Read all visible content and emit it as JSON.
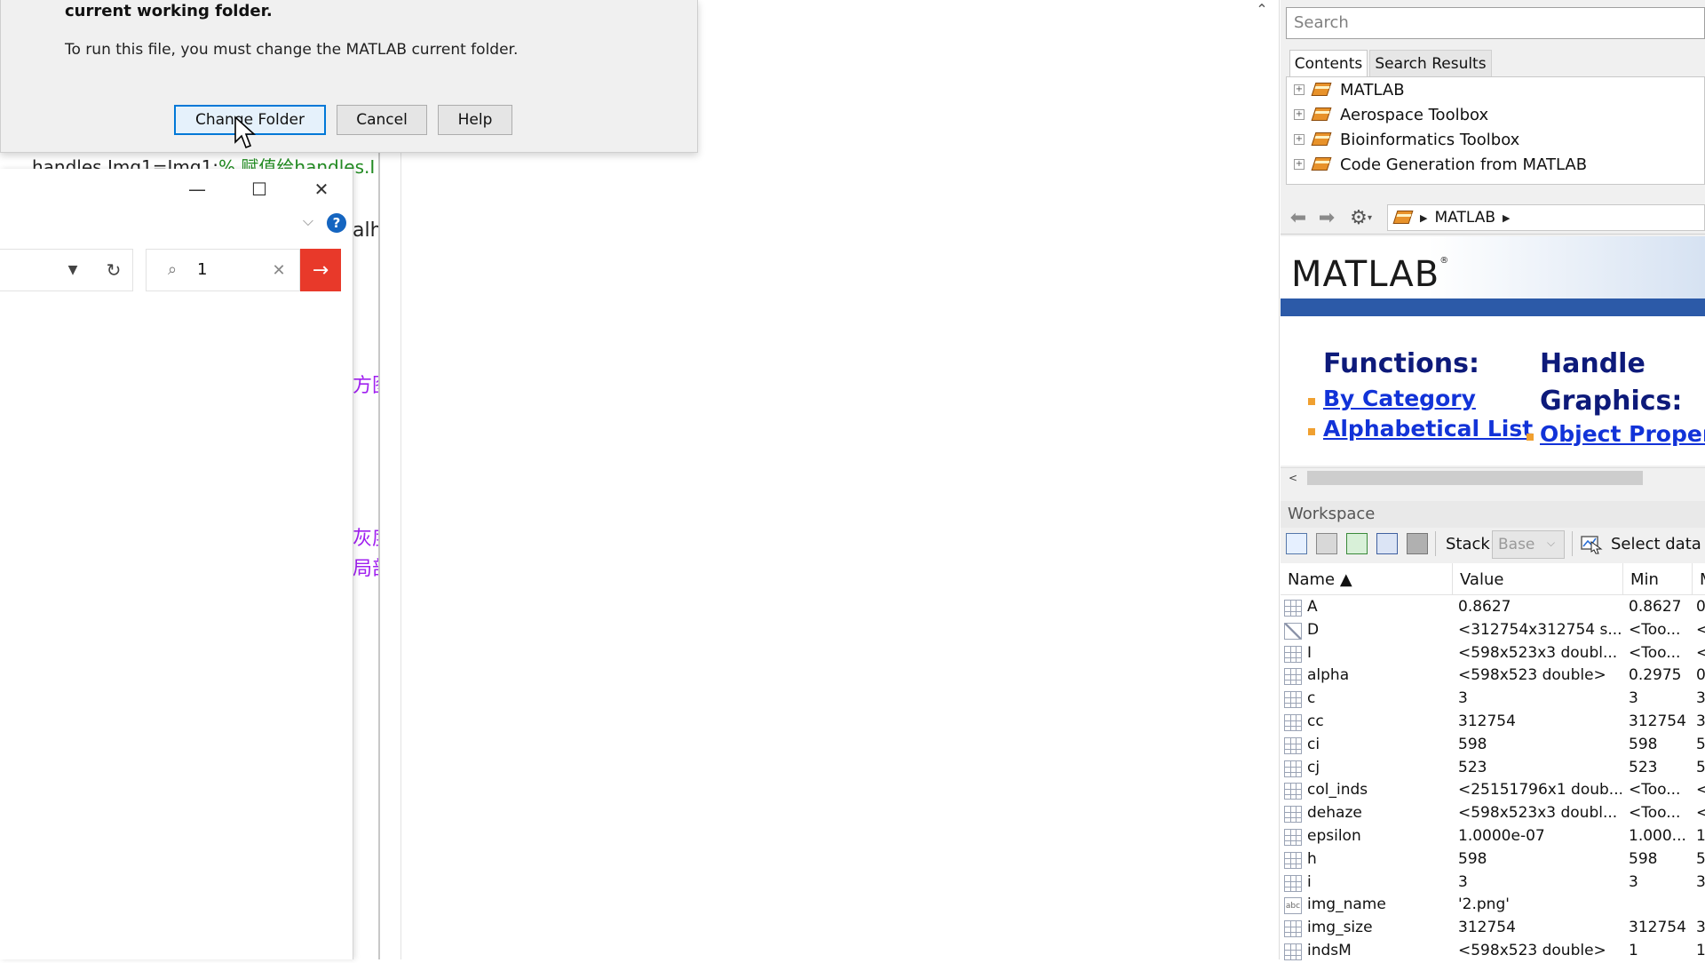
{
  "dialog": {
    "heading": "current working folder.",
    "message": "To run this file, you must change the MATLAB current folder.",
    "buttons": {
      "change_folder": "Change Folder",
      "cancel": "Cancel",
      "help": "Help"
    }
  },
  "editor": {
    "code_line": "handles.Img1=Img1;",
    "code_comment": "% 赋值给handles.I",
    "fragments": [
      "alh",
      "方图",
      "灰度",
      "局部"
    ]
  },
  "file_window": {
    "search_value": "1",
    "help_icon_glyph": "?",
    "controls": {
      "minimize": "—",
      "maximize": "☐",
      "close": "✕"
    }
  },
  "help_browser": {
    "search_placeholder": "Search",
    "tabs": [
      "Contents",
      "Search Results"
    ],
    "toc_items": [
      "MATLAB",
      "Aerospace Toolbox",
      "Bioinformatics Toolbox",
      "Code Generation from MATLAB"
    ],
    "breadcrumb": "MATLAB",
    "logo_text": "MATLAB",
    "logo_mark": "®",
    "content": {
      "functions_heading": "Functions:",
      "handle_heading": "Handle",
      "graphics_heading": "Graphics:",
      "link_by_category": "By Category",
      "link_alphabetical": "Alphabetical List",
      "link_object_properties": "Object Propert"
    }
  },
  "workspace": {
    "title": "Workspace",
    "stack_label": "Stack:",
    "stack_value": "Base",
    "select_data_label": "Select data t",
    "columns": {
      "name": "Name ▲",
      "value": "Value",
      "min": "Min",
      "max": "M"
    },
    "rows": [
      {
        "name": "A",
        "value": "0.8627",
        "min": "0.8627",
        "max": "0",
        "icon": "grid"
      },
      {
        "name": "D",
        "value": "<312754x312754 s...",
        "min": "<Too...",
        "max": "<",
        "icon": "sparse"
      },
      {
        "name": "I",
        "value": "<598x523x3 doubl...",
        "min": "<Too...",
        "max": "<",
        "icon": "grid"
      },
      {
        "name": "alpha",
        "value": "<598x523 double>",
        "min": "0.2975",
        "max": "0",
        "icon": "grid"
      },
      {
        "name": "c",
        "value": "3",
        "min": "3",
        "max": "3",
        "icon": "grid"
      },
      {
        "name": "cc",
        "value": "312754",
        "min": "312754",
        "max": "3",
        "icon": "grid"
      },
      {
        "name": "ci",
        "value": "598",
        "min": "598",
        "max": "5",
        "icon": "grid"
      },
      {
        "name": "cj",
        "value": "523",
        "min": "523",
        "max": "5",
        "icon": "grid"
      },
      {
        "name": "col_inds",
        "value": "<25151796x1 doub...",
        "min": "<Too...",
        "max": "<",
        "icon": "grid"
      },
      {
        "name": "dehaze",
        "value": "<598x523x3 doubl...",
        "min": "<Too...",
        "max": "<",
        "icon": "grid"
      },
      {
        "name": "epsilon",
        "value": "1.0000e-07",
        "min": "1.000...",
        "max": "1",
        "icon": "grid"
      },
      {
        "name": "h",
        "value": "598",
        "min": "598",
        "max": "5",
        "icon": "grid"
      },
      {
        "name": "i",
        "value": "3",
        "min": "3",
        "max": "3",
        "icon": "grid"
      },
      {
        "name": "img_name",
        "value": "'2.png'",
        "min": "",
        "max": "",
        "icon": "char"
      },
      {
        "name": "img_size",
        "value": "312754",
        "min": "312754",
        "max": "3",
        "icon": "grid"
      },
      {
        "name": "indsM",
        "value": "<598x523 double>",
        "min": "1",
        "max": "1",
        "icon": "grid"
      }
    ]
  },
  "colors": {
    "accent": "#0078d7",
    "go_button": "#e8392a",
    "help_heading": "#0d1a7a",
    "help_link": "#1233d8",
    "matlab_bar": "#2c5aa8"
  }
}
